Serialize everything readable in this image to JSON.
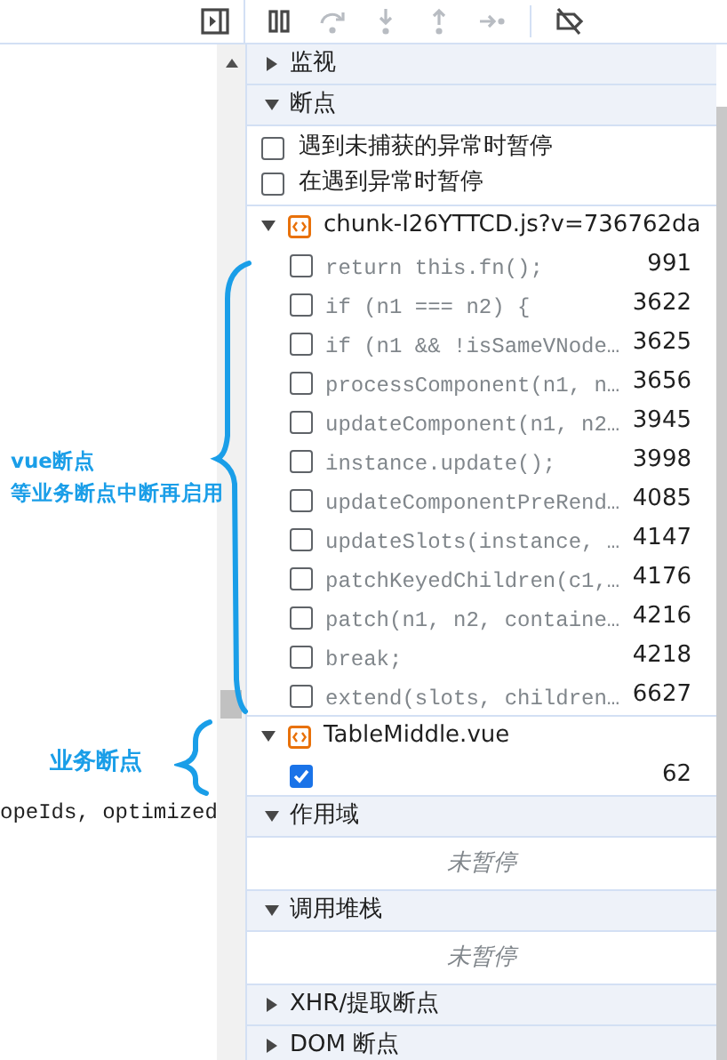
{
  "toolbar": {
    "buttons": [
      {
        "kind": "sidebar",
        "disabled": false
      },
      {
        "kind": "pause",
        "disabled": false
      },
      {
        "kind": "step-over",
        "disabled": true
      },
      {
        "kind": "step-into",
        "disabled": true
      },
      {
        "kind": "step-out",
        "disabled": true
      },
      {
        "kind": "step",
        "disabled": true
      },
      {
        "kind": "deactivate",
        "disabled": false
      }
    ]
  },
  "editor": {
    "line_fragment": "opeIds, optimized"
  },
  "annotations": [
    {
      "lines": [
        "vue断点",
        "等业务断点中断再启用"
      ]
    },
    {
      "lines": [
        "业务断点"
      ]
    }
  ],
  "sections": [
    {
      "title": "监视",
      "expanded": false
    },
    {
      "kind": "breakpoints",
      "title": "断点",
      "expanded": true,
      "options": [
        {
          "label": "遇到未捕获的异常时暂停",
          "checked": false
        },
        {
          "label": "在遇到异常时暂停",
          "checked": false
        }
      ],
      "files": [
        {
          "name": "chunk-I26YTTCD.js?v=736762da",
          "expanded": true,
          "breakpoints": [
            {
              "code": "return this.fn();",
              "line": "991",
              "checked": false
            },
            {
              "code": "if (n1 === n2) {",
              "line": "3622",
              "checked": false
            },
            {
              "code": "if (n1 && !isSameVNode…",
              "line": "3625",
              "checked": false
            },
            {
              "code": "processComponent(n1, n…",
              "line": "3656",
              "checked": false
            },
            {
              "code": "updateComponent(n1, n2…",
              "line": "3945",
              "checked": false
            },
            {
              "code": "instance.update();",
              "line": "3998",
              "checked": false
            },
            {
              "code": "updateComponentPreRend…",
              "line": "4085",
              "checked": false
            },
            {
              "code": "updateSlots(instance, …",
              "line": "4147",
              "checked": false
            },
            {
              "code": "patchKeyedChildren(c1,…",
              "line": "4176",
              "checked": false
            },
            {
              "code": "patch(n1, n2, containe…",
              "line": "4216",
              "checked": false
            },
            {
              "code": "break;",
              "line": "4218",
              "checked": false
            },
            {
              "code": "extend(slots, children…",
              "line": "6627",
              "checked": false
            }
          ]
        },
        {
          "name": "TableMiddle.vue",
          "expanded": true,
          "breakpoints": [
            {
              "line": "62",
              "checked": true
            }
          ]
        }
      ]
    },
    {
      "kind": "message",
      "title": "作用域",
      "expanded": true,
      "message": "未暂停"
    },
    {
      "kind": "message",
      "title": "调用堆栈",
      "expanded": true,
      "message": "未暂停"
    },
    {
      "title": "XHR/提取断点",
      "expanded": false
    },
    {
      "title": "DOM 断点",
      "expanded": false
    }
  ]
}
